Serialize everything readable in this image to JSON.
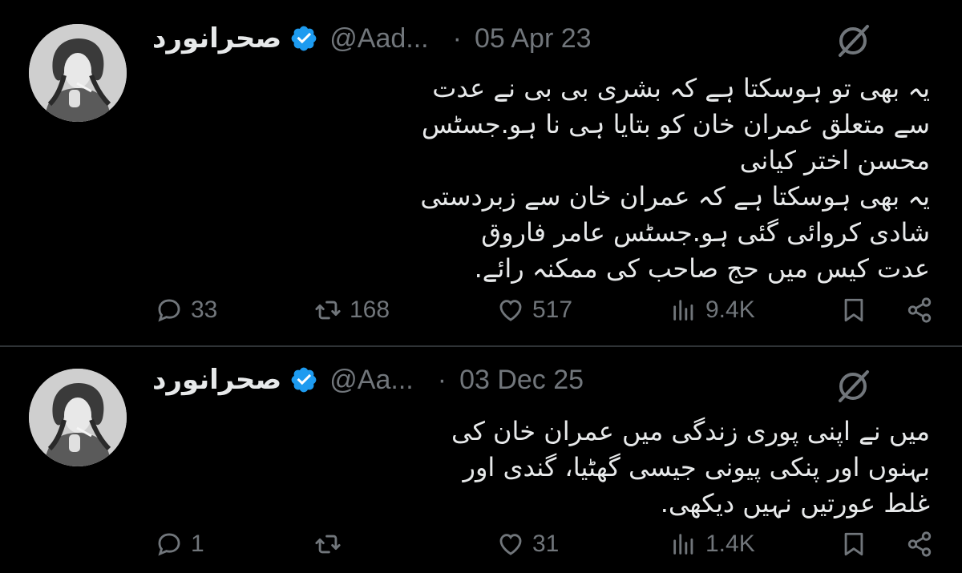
{
  "tweets": [
    {
      "display_name": "صحرانورد",
      "handle": "@Aad...",
      "separator": "·",
      "date": "05 Apr 23",
      "text": "یہ بھی تو ہوسکتا ہے کہ بشری بی بی نے عدت\nسے متعلق عمران خان کو بتایا ہی نا ہو.جسٹس\nمحسن اختر کیانی\nیہ بھی ہوسکتا ہے کہ عمران خان سے زبردستی\nشادی کروائی گئی ہو.جسٹس عامر فاروق\nعدت کیس میں حج صاحب کی ممکنہ رائے.",
      "replies": "33",
      "retweets": "168",
      "likes": "517",
      "views": "9.4K"
    },
    {
      "display_name": "صحرانورد",
      "handle": "@Aa...",
      "separator": "·",
      "date": "03 Dec 25",
      "text": "میں نے اپنی پوری زندگی میں عمران خان کی\nبہنوں اور پنکی پیونی جیسی گھٹیا، گندی اور\nغلط عورتیں نہیں دیکھی.",
      "replies": "1",
      "retweets": "",
      "likes": "31",
      "views": "1.4K"
    }
  ],
  "colors": {
    "background": "#000000",
    "text": "#e7e9ea",
    "muted": "#71767b",
    "verified": "#1d9bf0",
    "divider": "#2f3336"
  },
  "icons": [
    "verified-badge-icon",
    "grok-icon",
    "reply-icon",
    "retweet-icon",
    "like-icon",
    "views-icon",
    "bookmark-icon",
    "share-icon"
  ]
}
